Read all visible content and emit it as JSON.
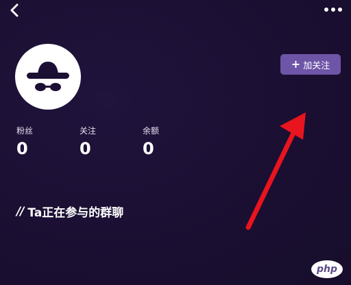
{
  "header": {
    "back_icon": "chevron-left-icon",
    "more_icon": "more-dots-icon"
  },
  "profile": {
    "avatar_icon": "incognito-hat-glasses-icon",
    "follow_button": {
      "icon": "plus",
      "label": "加关注"
    }
  },
  "stats": [
    {
      "label": "粉丝",
      "value": "0"
    },
    {
      "label": "关注",
      "value": "0"
    },
    {
      "label": "余额",
      "value": "0"
    }
  ],
  "section": {
    "prefix": "//",
    "title": "Ta正在参与的群聊"
  },
  "annotation": {
    "arrow_color": "#e8141e"
  },
  "watermark": {
    "text": "php"
  },
  "colors": {
    "background": "#1b1033",
    "button": "#6e55a8",
    "text": "#ffffff"
  }
}
